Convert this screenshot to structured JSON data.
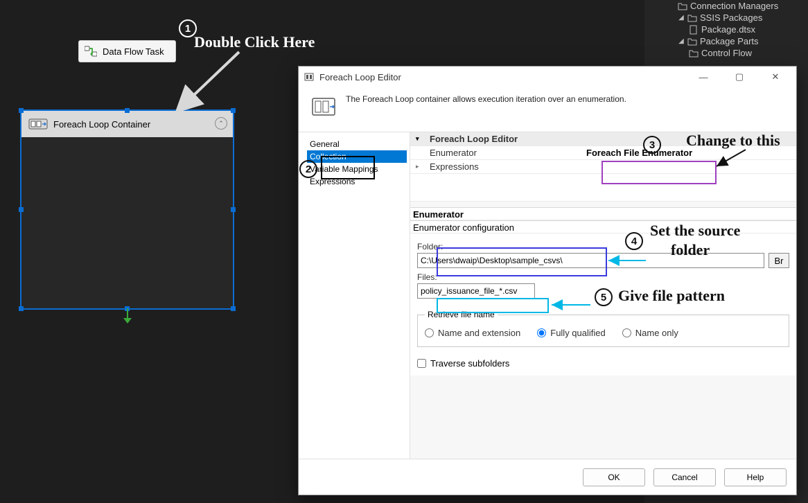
{
  "canvas": {
    "dataFlowTask": "Data Flow Task",
    "foreachContainer": "Foreach Loop Container"
  },
  "solution": {
    "connMgr": "Connection Managers",
    "ssisPkg": "SSIS Packages",
    "package": "Package.dtsx",
    "pkgParts": "Package Parts",
    "controlFlow": "Control Flow"
  },
  "dialog": {
    "title": "Foreach Loop Editor",
    "desc": "The Foreach Loop container allows execution iteration over an enumeration.",
    "nav": {
      "general": "General",
      "collection": "Collection",
      "varmap": "Variable Mappings",
      "expr": "Expressions"
    },
    "grid": {
      "group": "Foreach Loop Editor",
      "enumeratorK": "Enumerator",
      "enumeratorV": "Foreach File Enumerator",
      "expressionsK": "Expressions"
    },
    "enum": {
      "enumeratorHead": "Enumerator",
      "confHead": "Enumerator configuration",
      "folderLabel": "Folder:",
      "folderValue": "C:\\Users\\dwaip\\Desktop\\sample_csvs\\",
      "browseLabel": "Br",
      "filesLabel": "Files:",
      "filesValue": "policy_issuance_file_*.csv",
      "retrieveLegend": "Retrieve file name",
      "r1": "Name and extension",
      "r2": "Fully qualified",
      "r3": "Name only",
      "traverse": "Traverse subfolders"
    },
    "buttons": {
      "ok": "OK",
      "cancel": "Cancel",
      "help": "Help"
    }
  },
  "anno": {
    "a1": "Double Click Here",
    "a3": "Change to this",
    "a4a": "Set the source",
    "a4b": "folder",
    "a5": "Give file pattern"
  }
}
